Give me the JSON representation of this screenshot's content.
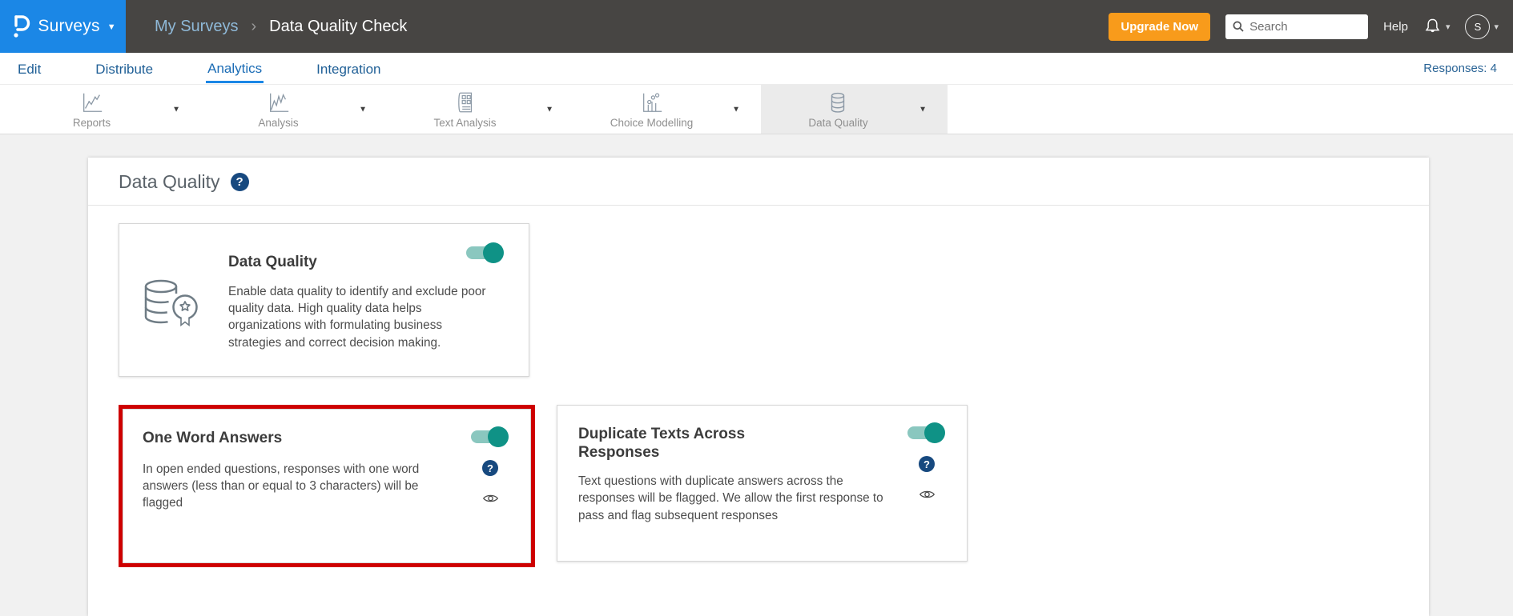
{
  "header": {
    "product": "Surveys",
    "breadcrumb": {
      "parent": "My Surveys",
      "current": "Data Quality Check"
    },
    "upgrade_label": "Upgrade Now",
    "search_placeholder": "Search",
    "help_label": "Help",
    "avatar_initial": "S"
  },
  "nav": {
    "items": [
      {
        "label": "Edit"
      },
      {
        "label": "Distribute"
      },
      {
        "label": "Analytics"
      },
      {
        "label": "Integration"
      }
    ],
    "responses": "Responses: 4"
  },
  "toolbar": {
    "items": [
      {
        "label": "Reports",
        "icon": "line-chart-icon"
      },
      {
        "label": "Analysis",
        "icon": "line-chart-icon"
      },
      {
        "label": "Text Analysis",
        "icon": "document-icon"
      },
      {
        "label": "Choice Modelling",
        "icon": "chart-dots-icon"
      },
      {
        "label": "Data Quality",
        "icon": "database-icon",
        "active": true
      }
    ]
  },
  "page": {
    "title": "Data Quality"
  },
  "cards": {
    "data_quality": {
      "title": "Data Quality",
      "toggle_on": true,
      "description": "Enable data quality to identify and exclude poor quality data. High quality data helps organizations with formulating business strategies and correct decision making."
    },
    "one_word": {
      "title": "One Word Answers",
      "toggle_on": true,
      "highlighted": true,
      "description": "In open ended questions, responses with one word answers (less than or equal to 3 characters) will be flagged"
    },
    "duplicate": {
      "title": "Duplicate Texts Across Responses",
      "toggle_on": true,
      "description": "Text questions with duplicate answers across the responses will be flagged. We allow the first response to pass and flag subsequent responses"
    }
  },
  "icons": {
    "caret": "▼",
    "caret_small": "▾",
    "breadcrumb_separator": "›",
    "help_glyph": "?"
  },
  "colors": {
    "accent_blue": "#1B87E6",
    "header_dark": "#474543",
    "toggle_teal": "#0F9286",
    "toggle_track": "#8AC7BF",
    "highlight_red": "#CE0000",
    "upgrade_orange": "#F89B1B",
    "help_navy": "#17497F"
  }
}
